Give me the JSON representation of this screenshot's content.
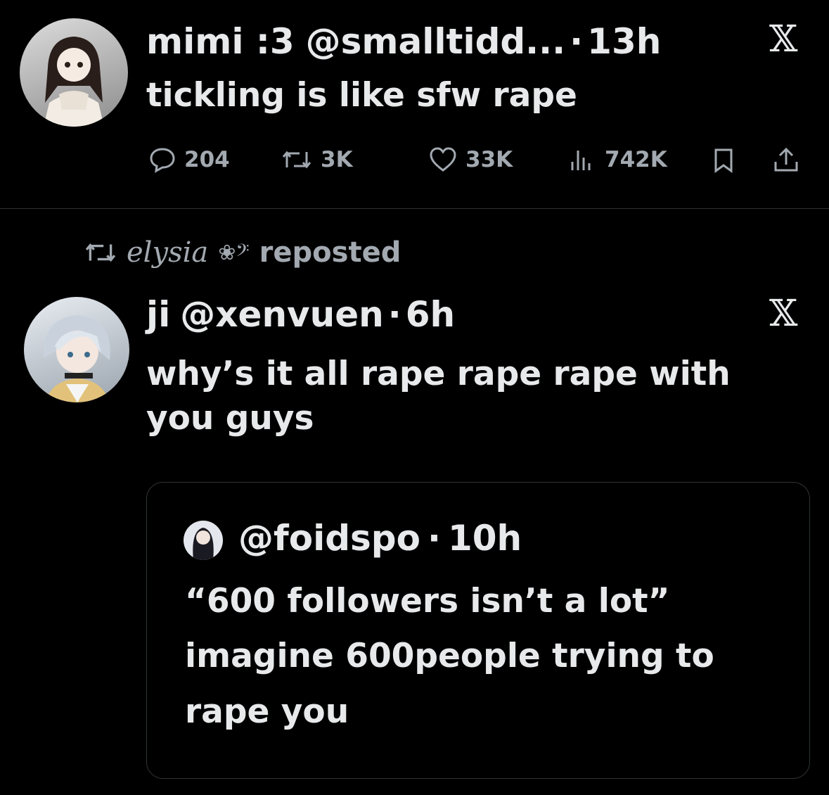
{
  "tweet1": {
    "display_name": "mimi :3",
    "handle": "@smalltidd...",
    "separator": "·",
    "time": "13h",
    "text": "tickling is like sfw rape",
    "stats": {
      "replies": "204",
      "reposts": "3K",
      "likes": "33K",
      "views": "742K"
    }
  },
  "repost_banner": {
    "reposter": "elysia",
    "reposter_symbols": "❀𝄢",
    "label": "reposted"
  },
  "tweet2": {
    "display_name": "ji",
    "handle": "@xenvuen",
    "separator": "·",
    "time": "6h",
    "text": "why’s it all rape rape rape with you guys",
    "quote": {
      "handle": "@foidspo",
      "separator": "·",
      "time": "10h",
      "text": "“600 followers isn’t a lot” imagine 600people trying to  rape you"
    }
  },
  "icons": {
    "platform": "x-logo-icon",
    "reply": "speech-bubble-icon",
    "repost": "repost-arrows-icon",
    "like": "heart-icon",
    "views": "bar-chart-icon",
    "bookmark": "bookmark-icon",
    "share": "share-icon"
  },
  "colors": {
    "background": "#000000",
    "text": "#e7e9ea",
    "muted": "#a2a9b0",
    "border": "#2f3336"
  }
}
